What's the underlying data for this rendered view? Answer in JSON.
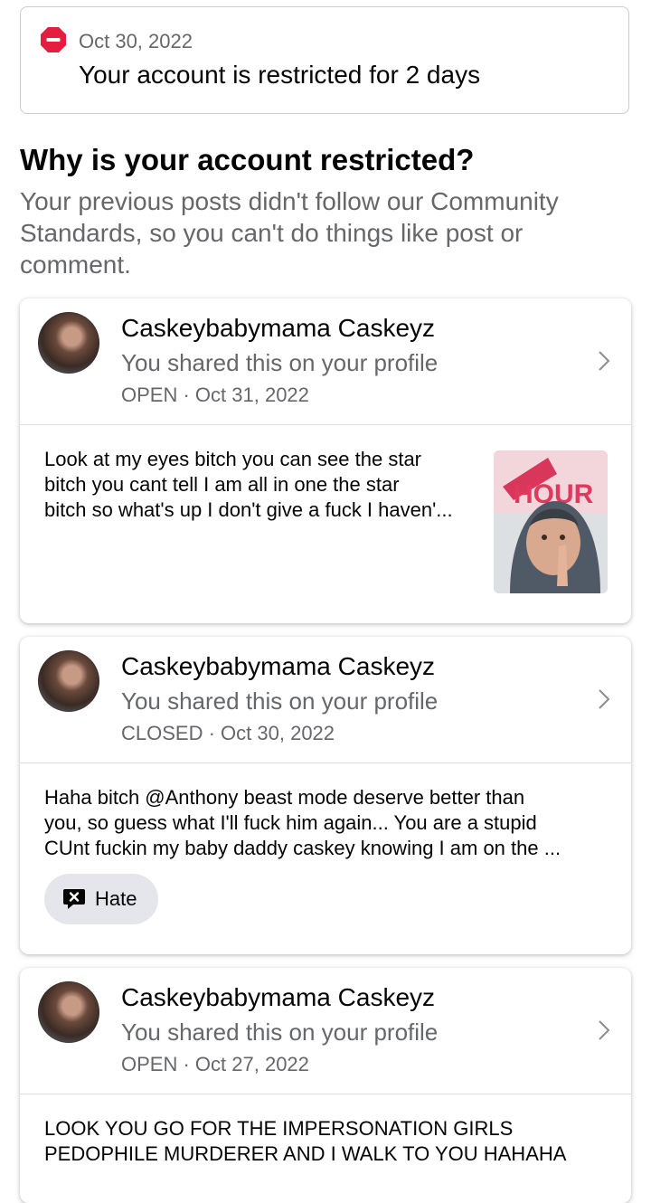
{
  "notice": {
    "date": "Oct 30, 2022",
    "title": "Your account is restricted for 2 days",
    "icon": "stop-icon",
    "icon_color": "#e41e3f"
  },
  "why": {
    "heading": "Why is your account restricted?",
    "explanation": "Your previous posts didn't follow our Community Standards, so you can't do things like post or comment."
  },
  "posts": [
    {
      "author": "Caskeybabymama Caskeyz",
      "shared": "You shared this on your profile",
      "status": "OPEN",
      "date": "Oct 31, 2022",
      "lines": [
        "Look at my eyes bitch you can see the star",
        "bitch you cant tell I am all in one the star",
        "bitch so what's up I don't give a fuck I haven'..."
      ],
      "thumb_sign": "HOUR"
    },
    {
      "author": "Caskeybabymama Caskeyz",
      "shared": "You shared this on your profile",
      "status": "CLOSED",
      "date": "Oct 30, 2022",
      "lines": [
        "Haha bitch @Anthony beast mode deserve better than",
        "you, so guess what I'll fuck him again... You are a stupid",
        "CUnt fuckin my baby daddy caskey knowing I am on the ..."
      ],
      "chip": "Hate"
    },
    {
      "author": "Caskeybabymama Caskeyz",
      "shared": "You shared this on your profile",
      "status": "OPEN",
      "date": "Oct 27, 2022",
      "lines": [
        "LOOK YOU GO FOR THE IMPERSONATION GIRLS",
        "PEDOPHILE MURDERER AND I WALK TO YOU HAHAHA"
      ]
    }
  ]
}
